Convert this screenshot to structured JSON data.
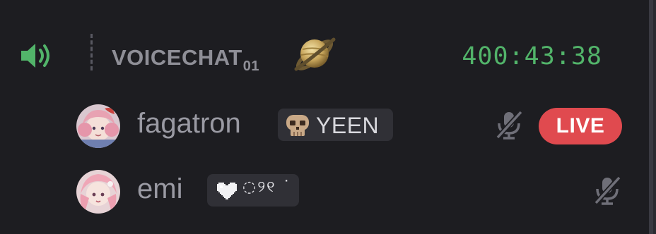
{
  "channel": {
    "name": "VOICECHAT",
    "name_suffix": "01",
    "speaker_icon": "speaker-volume-icon",
    "emoji_icon": "ringed-planet-icon",
    "elapsed": "400:43:38",
    "elapsed_color": "#52b46a"
  },
  "users": [
    {
      "name": "fagatron",
      "avatar_icon": "anime-avatar",
      "tag_icon": "skull-icon",
      "tag_text": "YEEN",
      "muted_icon": "mic-muted-icon",
      "live_label": "LIVE",
      "live_color": "#e04a4f"
    },
    {
      "name": "emi",
      "avatar_icon": "anime-avatar",
      "tag_icon": "pixel-heart-icon",
      "tag_glyphs": "◌୨୧ ˙",
      "muted_icon": "mic-muted-icon"
    }
  ]
}
